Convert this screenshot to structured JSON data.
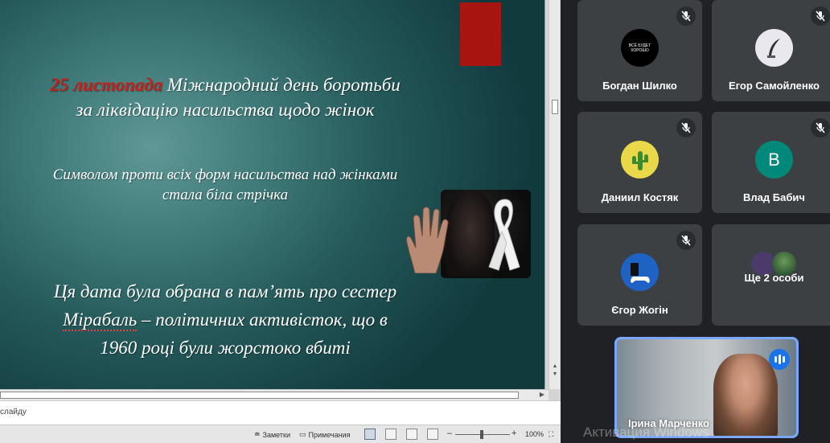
{
  "slide": {
    "line1_date": "25 листопада",
    "line1_rest": " Міжнародний день боротьби",
    "line2": "за ліквідацію насильства щодо жінок",
    "symbol_line1": "Символом проти всіх форм насильства над жінками",
    "symbol_line2": "стала біла стрічка",
    "date_line1": "Ця дата була обрана в пам’ять про сестер",
    "date_line2_a": "Мірабаль",
    "date_line2_b": " –  політичних активісток, що в",
    "date_line3": "1960 році були жорстоко вбиті"
  },
  "notes": {
    "placeholder": "слайду"
  },
  "statusbar": {
    "notes_label": "Заметки",
    "comments_label": "Примечания",
    "zoom": "100%",
    "minus": "–",
    "plus": "+"
  },
  "participants": [
    {
      "name": "Богдан Шилко",
      "avatar_text": "ВСЁ БУДЕТ ХОРОШО",
      "muted": true
    },
    {
      "name": "Егор Самойленко",
      "muted": true
    },
    {
      "name": "Даниил Костяк",
      "muted": true
    },
    {
      "name": "Влад Бабич",
      "avatar_letter": "B",
      "muted": true
    },
    {
      "name": "Єгор Жогін",
      "muted": true
    },
    {
      "name": "Ще 2 особи"
    }
  ],
  "self": {
    "name": "Ірина Марченко"
  },
  "watermark": "Активация Windows",
  "colors": {
    "meet_bg": "#202124",
    "tile_bg": "#3c4043",
    "accent_blue": "#1a73e8",
    "teal_avatar": "#00897b",
    "slide_red": "#a6150f"
  }
}
